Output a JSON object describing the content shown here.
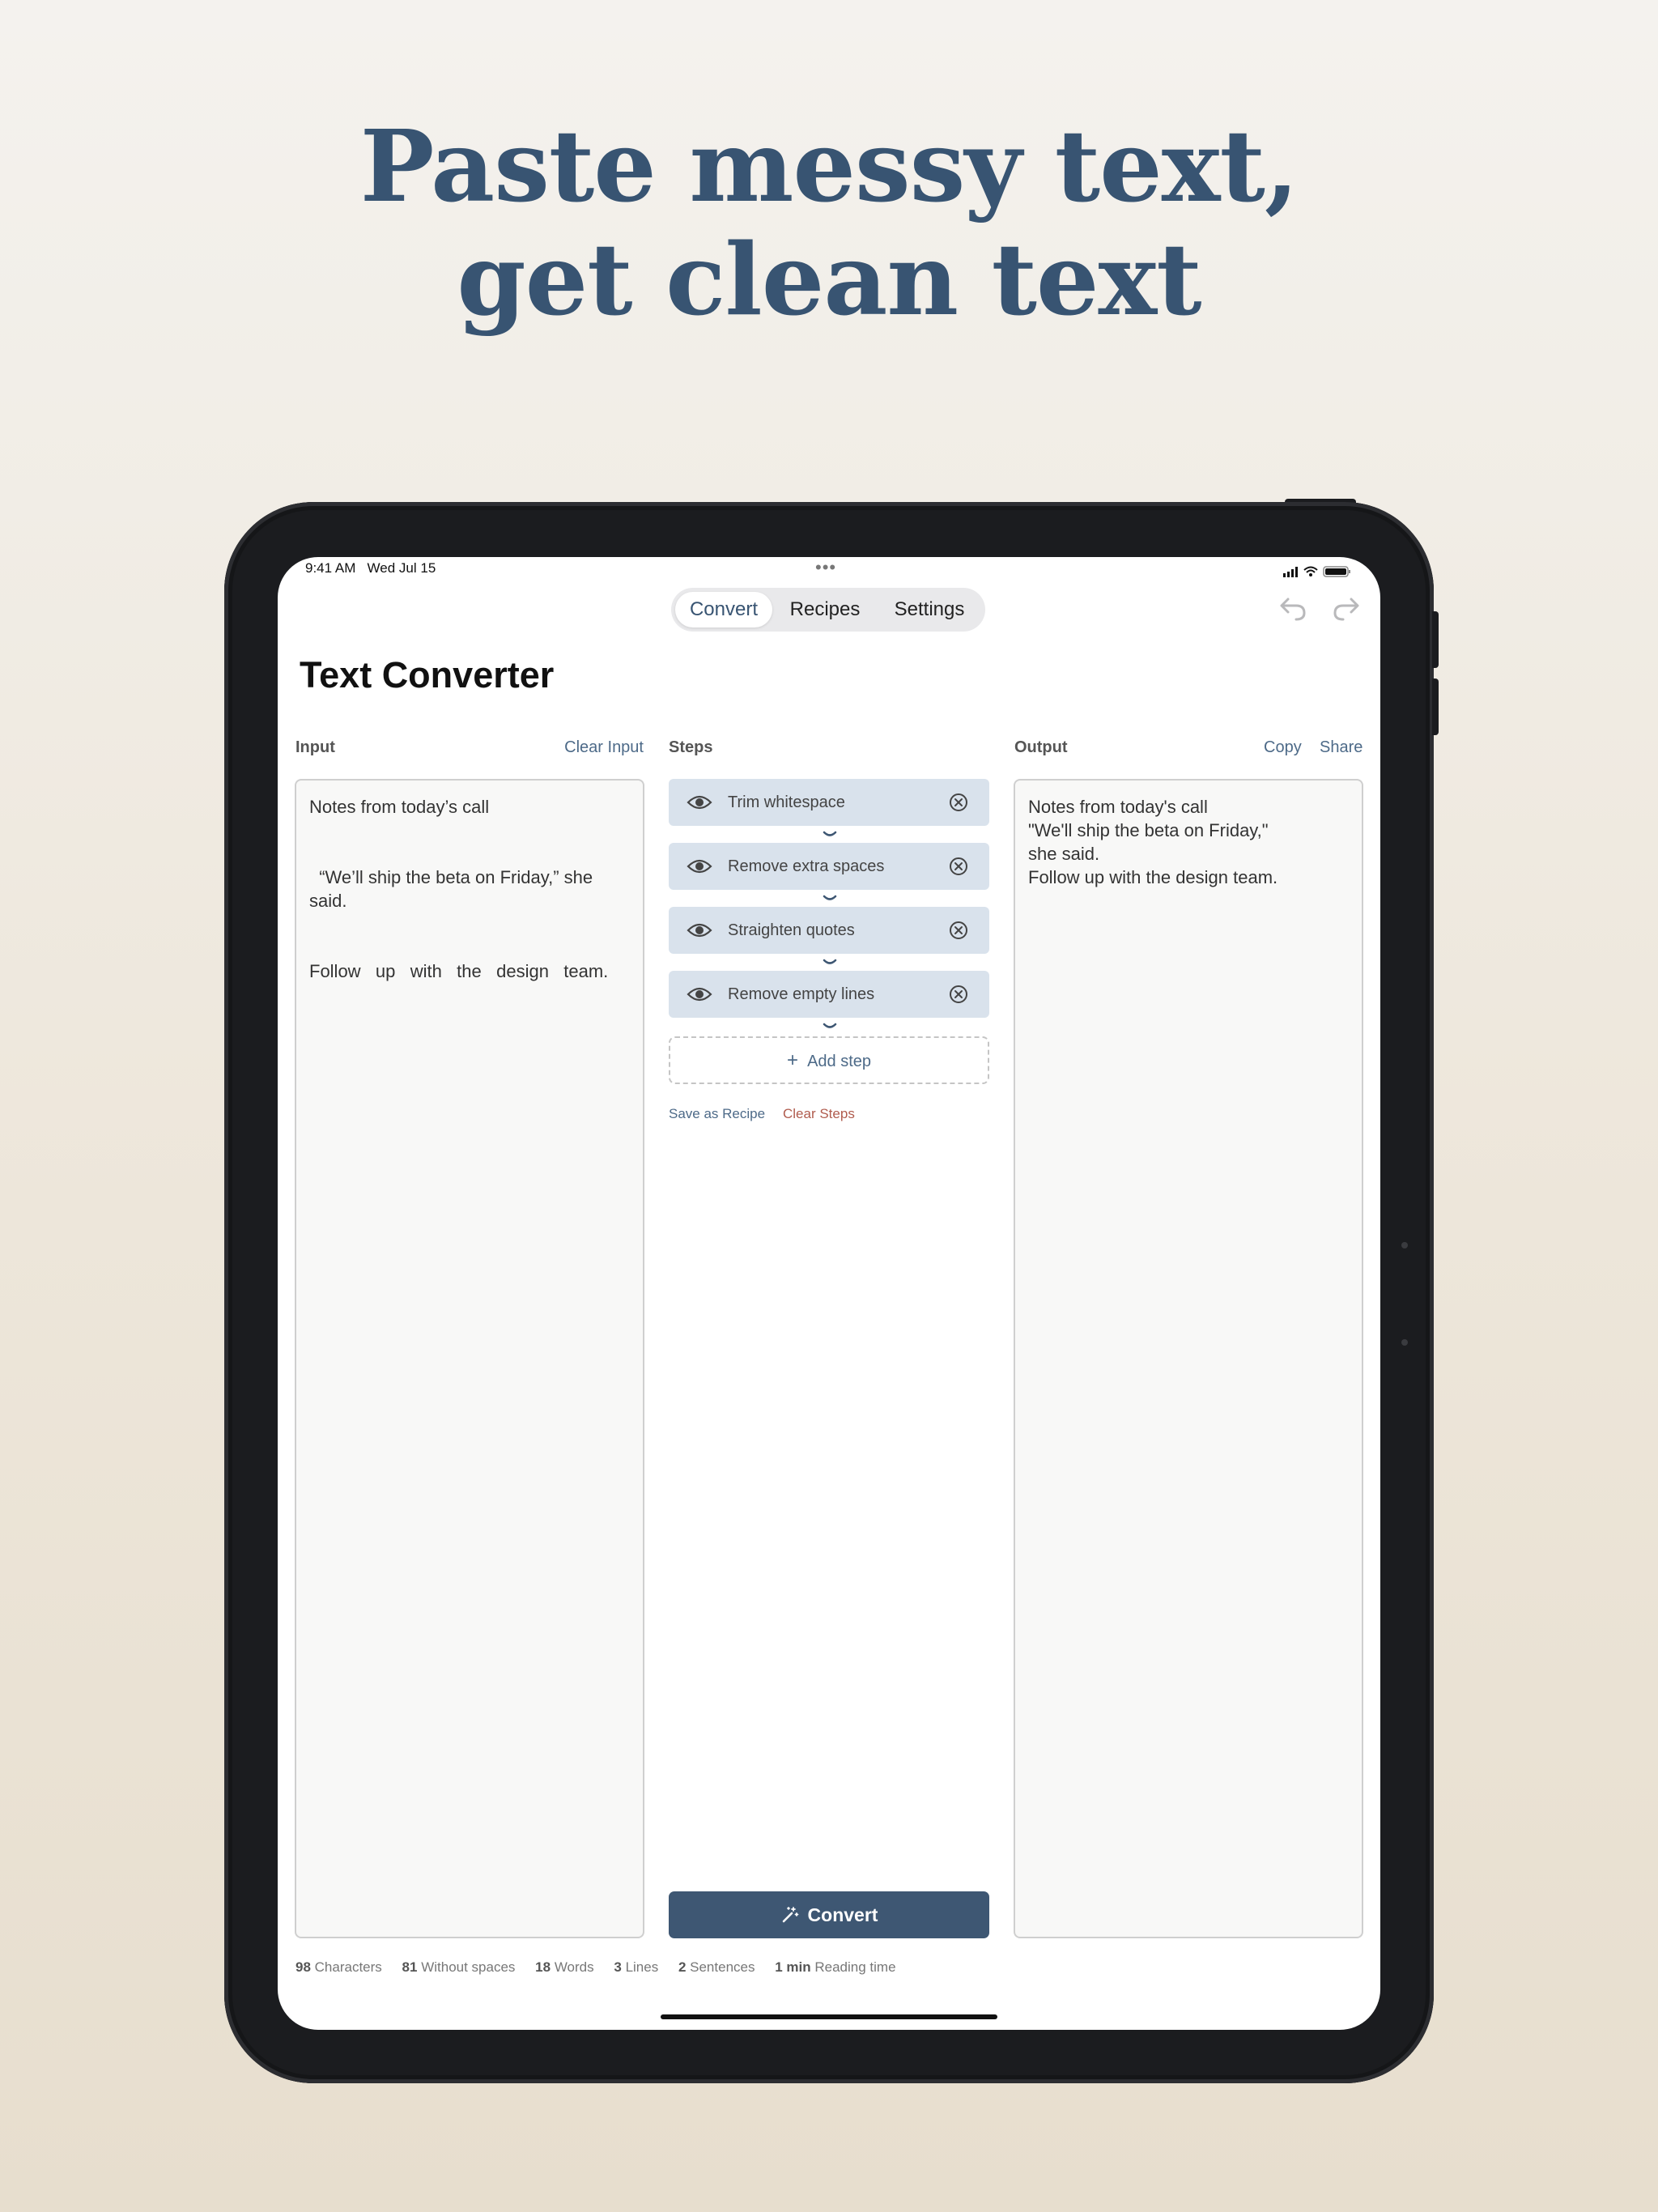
{
  "headline": {
    "line1": "Paste messy text,",
    "line2": "get clean text"
  },
  "status": {
    "time": "9:41 AM",
    "date": "Wed Jul 15",
    "dots": "•••"
  },
  "tabs": [
    {
      "label": "Convert",
      "active": true
    },
    {
      "label": "Recipes",
      "active": false
    },
    {
      "label": "Settings",
      "active": false
    }
  ],
  "title": "Text Converter",
  "input": {
    "label": "Input",
    "clear_label": "Clear Input",
    "lines": [
      "Notes from today’s call",
      "",
      "",
      "  “We’ll ship the beta on Friday,” she",
      "said.",
      "",
      "",
      "Follow   up   with   the   design   team."
    ]
  },
  "steps": {
    "label": "Steps",
    "items": [
      {
        "name": "Trim whitespace"
      },
      {
        "name": "Remove extra spaces"
      },
      {
        "name": "Straighten quotes"
      },
      {
        "name": "Remove empty lines"
      }
    ],
    "add_label": "Add step",
    "save_recipe_label": "Save as Recipe",
    "clear_steps_label": "Clear Steps",
    "convert_label": "Convert"
  },
  "output": {
    "label": "Output",
    "copy_label": "Copy",
    "share_label": "Share",
    "lines": [
      "Notes from today's call",
      "\"We'll ship the beta on Friday,\"",
      "she said.",
      "Follow up with the design team."
    ]
  },
  "stats": [
    {
      "value": "98",
      "label": "Characters"
    },
    {
      "value": "81",
      "label": "Without spaces"
    },
    {
      "value": "18",
      "label": "Words"
    },
    {
      "value": "3",
      "label": "Lines"
    },
    {
      "value": "2",
      "label": "Sentences"
    },
    {
      "value": "1 min",
      "label": "Reading time"
    }
  ],
  "colors": {
    "accent": "#385472",
    "button": "#3e5773",
    "step_bg": "#d9e2ec",
    "danger": "#b05c4e"
  }
}
